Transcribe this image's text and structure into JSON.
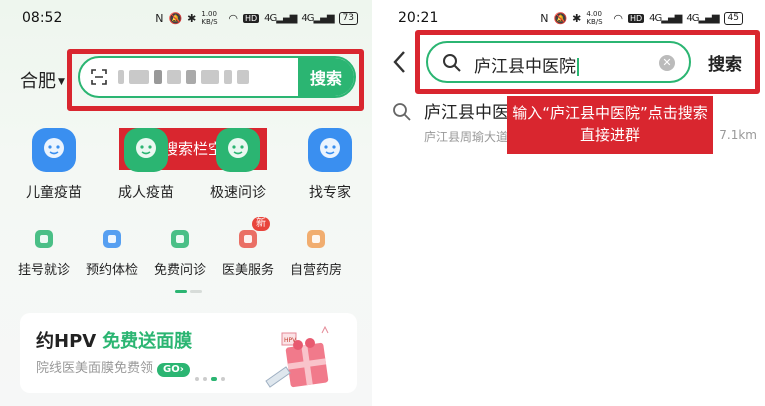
{
  "left_screen": {
    "status": {
      "time": "08:52",
      "net_speed": "1.00 KB/S",
      "battery": "73"
    },
    "city": "合肥",
    "search_button": "搜索",
    "callout": "点击搜索栏空白处",
    "main_icons": [
      {
        "label": "儿童疫苗",
        "icon": "baby-face-icon",
        "color": "#3a8ff0"
      },
      {
        "label": "成人疫苗",
        "icon": "syringe-icon",
        "color": "#2bb572"
      },
      {
        "label": "极速问诊",
        "icon": "chat-doctor-icon",
        "color": "#2bb572"
      },
      {
        "label": "找专家",
        "icon": "doctor-avatar-icon",
        "color": "#3a8ff0"
      }
    ],
    "sub_icons": [
      {
        "label": "挂号就诊",
        "icon": "registration-icon",
        "color": "#2bb572"
      },
      {
        "label": "预约体检",
        "icon": "checkup-report-icon",
        "color": "#3a8ff0"
      },
      {
        "label": "免费问诊",
        "icon": "free-consult-icon",
        "color": "#2bb572"
      },
      {
        "label": "医美服务",
        "icon": "beauty-service-icon",
        "color": "#e8574b",
        "badge": "新"
      },
      {
        "label": "自营药房",
        "icon": "pill-icon",
        "color": "#f0a057"
      }
    ],
    "promo": {
      "title": "约HPV",
      "title_highlight": "免费送面膜",
      "subtitle": "院线医美面膜免费领",
      "go": "GO",
      "tag": "HPV"
    }
  },
  "right_screen": {
    "status": {
      "time": "20:21",
      "net_speed": "4.00 KB/S",
      "battery": "45"
    },
    "query": "庐江县中医院",
    "search_button": "搜索",
    "callout": "输入“庐江县中医院”点击搜索直接进群",
    "result": {
      "name": "庐江县中医",
      "address": "庐江县周瑜大道",
      "distance": "7.1km"
    }
  },
  "colors": {
    "brand_green": "#2bb572",
    "annotation_red": "#d9262f"
  }
}
